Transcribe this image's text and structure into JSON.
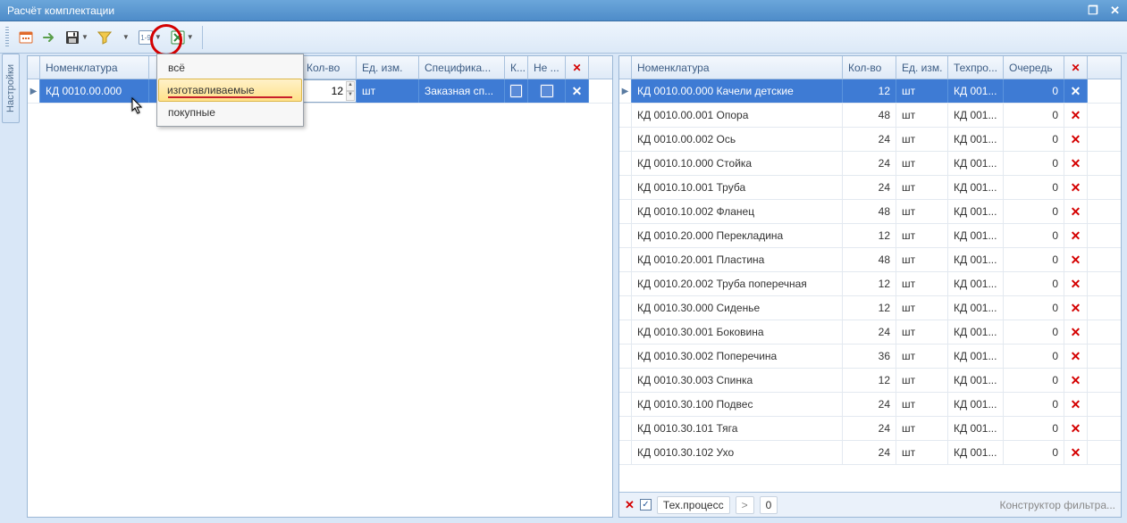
{
  "window": {
    "title": "Расчёт комплектации"
  },
  "toolbar": {},
  "dropdown": {
    "items": [
      {
        "label": "всё"
      },
      {
        "label": "изготавливаемые",
        "highlight": true,
        "underline": true
      },
      {
        "label": "покупные"
      }
    ]
  },
  "sidebar": {
    "tab_label": "Настройки"
  },
  "left_grid": {
    "headers": {
      "nomenclature": "Номенклатура",
      "name_extra": "",
      "qty": "Кол-во",
      "unit": "Ед. изм.",
      "spec": "Специфика...",
      "k": "К...",
      "ne": "Не ..."
    },
    "rows": [
      {
        "nomenclature": "КД 0010.00.000",
        "qty": "12",
        "unit": "шт",
        "spec": "Заказная сп...",
        "selected": true
      }
    ]
  },
  "right_grid": {
    "headers": {
      "nomenclature": "Номенклатура",
      "qty": "Кол-во",
      "unit": "Ед. изм.",
      "tech": "Техпро...",
      "queue": "Очередь"
    },
    "rows": [
      {
        "n": "КД 0010.00.000 Качели детские",
        "q": "12",
        "u": "шт",
        "t": "КД 001...",
        "o": "0",
        "sel": true
      },
      {
        "n": "КД 0010.00.001 Опора",
        "q": "48",
        "u": "шт",
        "t": "КД 001...",
        "o": "0"
      },
      {
        "n": "КД 0010.00.002 Ось",
        "q": "24",
        "u": "шт",
        "t": "КД 001...",
        "o": "0"
      },
      {
        "n": "КД 0010.10.000 Стойка",
        "q": "24",
        "u": "шт",
        "t": "КД 001...",
        "o": "0"
      },
      {
        "n": "КД 0010.10.001 Труба",
        "q": "24",
        "u": "шт",
        "t": "КД 001...",
        "o": "0"
      },
      {
        "n": "КД 0010.10.002 Фланец",
        "q": "48",
        "u": "шт",
        "t": "КД 001...",
        "o": "0"
      },
      {
        "n": "КД 0010.20.000 Перекладина",
        "q": "12",
        "u": "шт",
        "t": "КД 001...",
        "o": "0"
      },
      {
        "n": "КД 0010.20.001 Пластина",
        "q": "48",
        "u": "шт",
        "t": "КД 001...",
        "o": "0"
      },
      {
        "n": "КД 0010.20.002 Труба поперечная",
        "q": "12",
        "u": "шт",
        "t": "КД 001...",
        "o": "0"
      },
      {
        "n": "КД 0010.30.000 Сиденье",
        "q": "12",
        "u": "шт",
        "t": "КД 001...",
        "o": "0"
      },
      {
        "n": "КД 0010.30.001 Боковина",
        "q": "24",
        "u": "шт",
        "t": "КД 001...",
        "o": "0"
      },
      {
        "n": "КД 0010.30.002 Поперечина",
        "q": "36",
        "u": "шт",
        "t": "КД 001...",
        "o": "0"
      },
      {
        "n": "КД 0010.30.003 Спинка",
        "q": "12",
        "u": "шт",
        "t": "КД 001...",
        "o": "0"
      },
      {
        "n": "КД 0010.30.100 Подвес",
        "q": "24",
        "u": "шт",
        "t": "КД 001...",
        "o": "0"
      },
      {
        "n": "КД 0010.30.101 Тяга",
        "q": "24",
        "u": "шт",
        "t": "КД 001...",
        "o": "0"
      },
      {
        "n": "КД 0010.30.102 Ухо",
        "q": "24",
        "u": "шт",
        "t": "КД 001...",
        "o": "0"
      }
    ]
  },
  "filter_bar": {
    "column": "Тех.процесс",
    "value": "0",
    "constructor_link": "Конструктор фильтра..."
  }
}
